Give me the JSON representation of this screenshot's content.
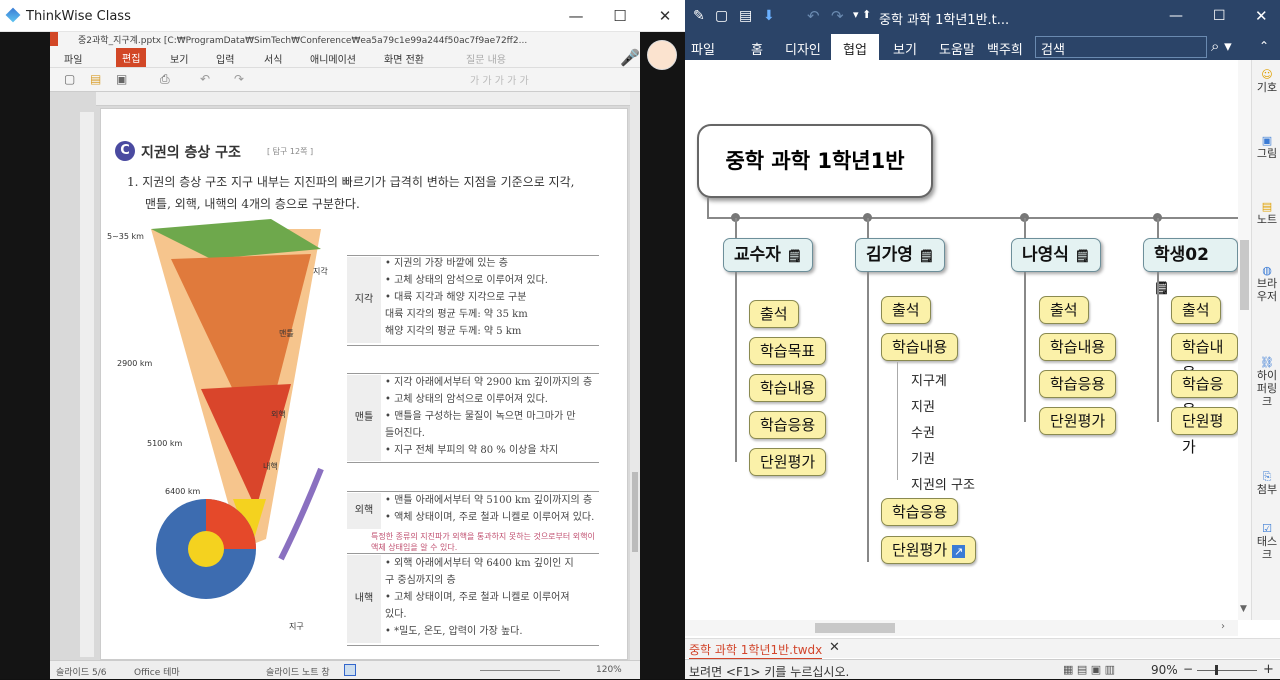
{
  "left_window": {
    "title": "ThinkWise Class",
    "min": "—",
    "max": "☐",
    "close": "✕"
  },
  "ppt": {
    "titlebar": "중2과학_지구계.pptx [C:₩ProgramData₩SimTech₩Conference₩ea5a79c1e99a244f50ac7f9ae72ff2...",
    "menu": [
      "파일",
      "편집",
      "보기",
      "입력",
      "서식",
      "애니메이션",
      "화면 전환",
      "질문 내용"
    ],
    "status": {
      "slide": "슬라이드 5/6",
      "theme": "Office 테마",
      "notes": "슬라이드 노트 창",
      "zoom": "120%"
    }
  },
  "slide": {
    "badge": "C",
    "heading": "지권의 층상 구조",
    "tag": "[ 탐구 12쪽 ]",
    "intro1": "1. 지권의 층상 구조  지구 내부는 지진파의 빠르기가 급격히 변하는 지점을 기준으로 지각,",
    "intro2": "맨틀, 외핵, 내핵의 4개의 층으로 구분한다.",
    "depths": [
      "5~35 km",
      "2900 km",
      "5100 km",
      "6400 km"
    ],
    "layers": [
      "지각",
      "맨틀",
      "외핵",
      "내핵",
      "지구"
    ],
    "crust_label": "지각",
    "crust": [
      "• 지권의 가장 바깥에 있는 층",
      "• 고체 상태의 암석으로 이루어져 있다.",
      "• 대륙 지각과 해양 지각으로 구분",
      "  대륙 지각의 평균 두께: 약 35 km",
      "  해양 지각의 평균 두께: 약 5 km"
    ],
    "mantle_label": "맨틀",
    "mantle": [
      "• 지각 아래에서부터 약 2900 km 깊이까지의 층",
      "• 고체 상태의 암석으로 이루어져 있다.",
      "• 맨틀을 구성하는 물질이 녹으면 마그마가 만",
      "  들어진다.",
      "• 지구 전체 부피의 약 80 % 이상을 차지"
    ],
    "outer_label": "외핵",
    "outer": [
      "• 맨틀 아래에서부터 약 5100 km 깊이까지의 층",
      "• 액체 상태이며, 주로 철과 니켈로 이루어져 있다."
    ],
    "outer_note": "특정한 종류의 지진파가 외핵을 통과하지 못하는 것으로부터 외핵이",
    "outer_note2": "액체 상태임을 알 수 있다.",
    "inner_label": "내핵",
    "inner": [
      "• 외핵 아래에서부터 약 6400 km 깊이인 지",
      "  구 중심까지의 층",
      "• 고체 상태이며, 주로 철과 니켈로 이루어져",
      "  있다.",
      "• *밀도, 온도, 압력이 가장 높다."
    ]
  },
  "thinkwise": {
    "title": "중학 과학 1학년1반.t...",
    "tabs": [
      "파일",
      "홈",
      "디자인",
      "협업",
      "보기",
      "도움말",
      "백주희"
    ],
    "active_tab": "협업",
    "search_placeholder": "검색",
    "root": "중학 과학 1학년1반",
    "branches": [
      {
        "name": "교수자",
        "children": [
          "출석",
          "학습목표",
          "학습내용",
          "학습응용",
          "단원평가"
        ]
      },
      {
        "name": "김가영",
        "children": [
          "출석",
          "학습내용",
          "학습응용",
          "단원평가"
        ],
        "leaves": [
          "지구계",
          "지권",
          "수권",
          "기권",
          "지권의 구조"
        ]
      },
      {
        "name": "나영식",
        "children": [
          "출석",
          "학습내용",
          "학습응용",
          "단원평가"
        ]
      },
      {
        "name": "학생02",
        "children": [
          "출석",
          "학습내용",
          "학습응용",
          "단원평가"
        ]
      }
    ],
    "side": [
      "기호",
      "그림",
      "노트",
      "브라우저",
      "하이퍼링크",
      "첨부",
      "태스크"
    ],
    "doc_tab": "중학 과학 1학년1반.twdx",
    "status": "보려면 <F1> 키를 누르십시오.",
    "zoom": "90%"
  },
  "colors": {
    "accent": "#2b4468",
    "node": "#fbf1a9",
    "main_node": "#e4f2f2"
  }
}
